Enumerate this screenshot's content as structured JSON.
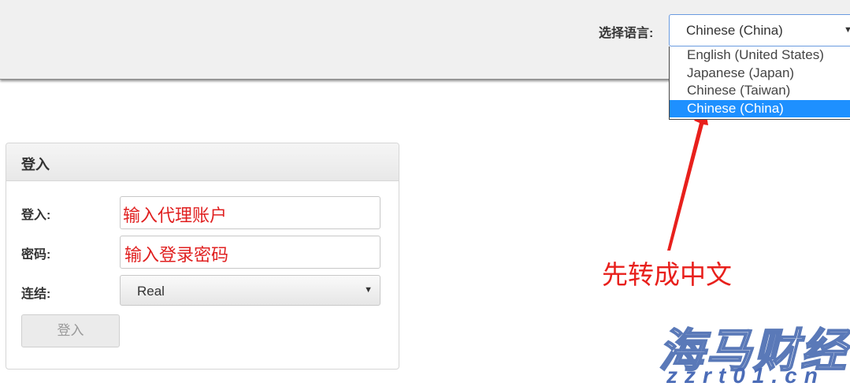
{
  "header": {
    "language_label": "选择语言:",
    "language_selected": "Chinese (China)",
    "language_options": [
      {
        "label": "English (United States)",
        "selected": false
      },
      {
        "label": "Japanese (Japan)",
        "selected": false
      },
      {
        "label": "Chinese (Taiwan)",
        "selected": false
      },
      {
        "label": "Chinese (China)",
        "selected": true
      }
    ]
  },
  "login": {
    "title": "登入",
    "username_label": "登入:",
    "username_value": "输入代理账户",
    "password_label": "密码:",
    "password_value": "输入登录密码",
    "connection_label": "连结:",
    "connection_value": "Real",
    "submit_label": "登入"
  },
  "annotation": {
    "text": "先转成中文",
    "color": "#e8201c"
  },
  "watermark": {
    "logo": "海马财经",
    "url": "zzrt01.cn"
  },
  "colors": {
    "selected_option": "#1e90ff",
    "input_text": "#e02020"
  }
}
